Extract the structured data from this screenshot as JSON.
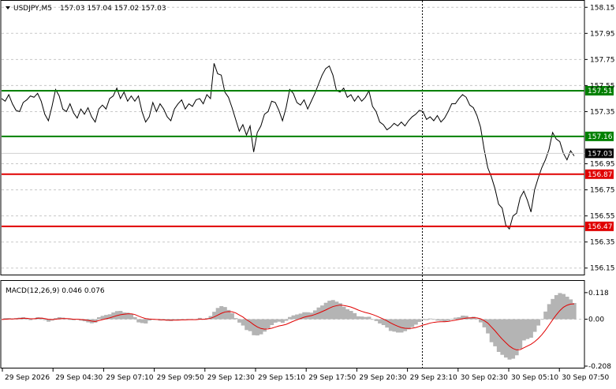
{
  "header": {
    "symbol_label": "USDJPY,M5",
    "ohlc": "157.03 157.04 157.02 157.03"
  },
  "macd_header": "MACD(12,26,9) 0.046 0.076",
  "colors": {
    "background": "#ffffff",
    "price_line": "#000000",
    "grid": "#c8c8c8",
    "resistance": "#008000",
    "support": "#e00000",
    "macd_hist": "#b4b4b4",
    "macd_signal": "#e00000",
    "current_price_bg": "#000000"
  },
  "chart_data": [
    {
      "type": "line",
      "title": "USDJPY,M5",
      "y_ticks": [
        "158.15",
        "157.95",
        "157.75",
        "157.55",
        "157.35",
        "156.95",
        "156.75",
        "156.55",
        "156.35",
        "156.15"
      ],
      "ylim": [
        156.1,
        158.2
      ],
      "x_tick_labels": [
        "29 Sep 2026",
        "29 Sep 04:30",
        "29 Sep 07:10",
        "29 Sep 09:50",
        "29 Sep 12:30",
        "29 Sep 15:10",
        "29 Sep 17:50",
        "29 Sep 20:30",
        "29 Sep 23:10",
        "30 Sep 02:30",
        "30 Sep 05:10",
        "30 Sep 07:50"
      ],
      "current_price": "157.03",
      "levels": [
        {
          "value": 157.51,
          "label": "157.51",
          "color": "#008000"
        },
        {
          "value": 157.16,
          "label": "157.16",
          "color": "#008000"
        },
        {
          "value": 156.87,
          "label": "156.87",
          "color": "#e00000"
        },
        {
          "value": 156.47,
          "label": "156.47",
          "color": "#e00000"
        }
      ],
      "series": [
        {
          "values": [
            157.45,
            157.43,
            157.48,
            157.41,
            157.36,
            157.35,
            157.42,
            157.44,
            157.47,
            157.46,
            157.49,
            157.43,
            157.33,
            157.28,
            157.39,
            157.52,
            157.47,
            157.37,
            157.35,
            157.41,
            157.34,
            157.3,
            157.37,
            157.33,
            157.38,
            157.31,
            157.27,
            157.37,
            157.4,
            157.37,
            157.45,
            157.47,
            157.53,
            157.45,
            157.5,
            157.43,
            157.47,
            157.43,
            157.47,
            157.35,
            157.27,
            157.31,
            157.42,
            157.35,
            157.41,
            157.37,
            157.31,
            157.28,
            157.37,
            157.41,
            157.44,
            157.37,
            157.41,
            157.39,
            157.44,
            157.45,
            157.41,
            157.48,
            157.45,
            157.72,
            157.64,
            157.63,
            157.5,
            157.46,
            157.38,
            157.29,
            157.2,
            157.25,
            157.17,
            157.24,
            157.04,
            157.19,
            157.24,
            157.33,
            157.35,
            157.43,
            157.42,
            157.36,
            157.28,
            157.38,
            157.52,
            157.49,
            157.42,
            157.4,
            157.44,
            157.37,
            157.43,
            157.49,
            157.56,
            157.63,
            157.68,
            157.7,
            157.63,
            157.51,
            157.5,
            157.53,
            157.46,
            157.48,
            157.43,
            157.47,
            157.43,
            157.46,
            157.51,
            157.39,
            157.35,
            157.27,
            157.25,
            157.21,
            157.23,
            157.26,
            157.24,
            157.27,
            157.24,
            157.28,
            157.31,
            157.33,
            157.36,
            157.35,
            157.29,
            157.31,
            157.28,
            157.32,
            157.27,
            157.3,
            157.35,
            157.41,
            157.41,
            157.45,
            157.48,
            157.46,
            157.4,
            157.38,
            157.32,
            157.23,
            157.06,
            156.92,
            156.85,
            156.76,
            156.64,
            156.61,
            156.48,
            156.45,
            156.55,
            156.57,
            156.69,
            156.74,
            156.67,
            156.58,
            156.75,
            156.84,
            156.92,
            156.98,
            157.06,
            157.19,
            157.14,
            157.12,
            157.03,
            156.98,
            157.05,
            157.01
          ]
        }
      ]
    },
    {
      "type": "bar",
      "title": "MACD(12,26,9)",
      "y_ticks": [
        "0.118",
        "0.00",
        "-0.208"
      ],
      "ylim": [
        -0.215,
        0.17
      ],
      "series": [
        {
          "name": "MACD",
          "values": [
            0.0,
            0.005,
            0.005,
            0.003,
            0.005,
            0.007,
            0.009,
            0.003,
            -0.004,
            0.004,
            0.009,
            0.007,
            -0.004,
            -0.011,
            -0.006,
            0.005,
            0.009,
            0.007,
            0.003,
            -0.003,
            -0.004,
            0.001,
            -0.006,
            -0.009,
            -0.014,
            -0.018,
            -0.015,
            0.009,
            0.015,
            0.019,
            0.022,
            0.03,
            0.036,
            0.037,
            0.03,
            0.029,
            0.025,
            0.009,
            -0.014,
            -0.017,
            -0.019,
            -0.006,
            -0.002,
            -0.002,
            -0.006,
            -0.005,
            -0.007,
            -0.008,
            -0.003,
            -0.004,
            -0.001,
            -0.003,
            0.001,
            -0.001,
            -0.001,
            0.006,
            0.0,
            0.005,
            0.014,
            0.033,
            0.05,
            0.058,
            0.054,
            0.041,
            0.027,
            0.005,
            -0.015,
            -0.028,
            -0.048,
            -0.053,
            -0.071,
            -0.072,
            -0.067,
            -0.055,
            -0.04,
            -0.026,
            -0.015,
            -0.011,
            -0.016,
            -0.007,
            0.01,
            0.017,
            0.021,
            0.025,
            0.031,
            0.031,
            0.029,
            0.039,
            0.052,
            0.061,
            0.073,
            0.082,
            0.085,
            0.078,
            0.071,
            0.055,
            0.044,
            0.037,
            0.027,
            0.013,
            0.012,
            0.01,
            0.011,
            0.0,
            -0.008,
            -0.019,
            -0.026,
            -0.037,
            -0.052,
            -0.055,
            -0.059,
            -0.059,
            -0.053,
            -0.045,
            -0.035,
            -0.024,
            -0.012,
            -0.003,
            -0.004,
            0.003,
            0.0,
            -0.006,
            -0.007,
            -0.012,
            -0.007,
            0.002,
            0.007,
            0.009,
            0.016,
            0.015,
            0.008,
            0.011,
            0.003,
            -0.014,
            -0.036,
            -0.063,
            -0.102,
            -0.12,
            -0.145,
            -0.158,
            -0.17,
            -0.179,
            -0.175,
            -0.16,
            -0.131,
            -0.094,
            -0.088,
            -0.082,
            -0.056,
            -0.028,
            -0.002,
            0.034,
            0.067,
            0.09,
            0.107,
            0.116,
            0.112,
            0.1,
            0.088,
            0.072
          ]
        },
        {
          "name": "Signal",
          "values": [
            -0.001,
            0.0,
            0.001,
            0.001,
            0.002,
            0.003,
            0.004,
            0.004,
            0.002,
            0.002,
            0.004,
            0.005,
            0.003,
            0.0,
            -0.001,
            0.0,
            0.002,
            0.003,
            0.003,
            0.002,
            0.0,
            0.0,
            -0.001,
            -0.003,
            -0.005,
            -0.008,
            -0.01,
            -0.006,
            -0.002,
            0.002,
            0.006,
            0.011,
            0.016,
            0.02,
            0.022,
            0.024,
            0.024,
            0.021,
            0.014,
            0.008,
            0.003,
            0.001,
            0.0,
            -0.001,
            -0.002,
            -0.003,
            -0.004,
            -0.004,
            -0.004,
            -0.004,
            -0.003,
            -0.003,
            -0.002,
            -0.002,
            -0.002,
            0.0,
            0.0,
            0.001,
            0.004,
            0.01,
            0.018,
            0.026,
            0.032,
            0.034,
            0.033,
            0.028,
            0.019,
            0.01,
            -0.002,
            -0.012,
            -0.024,
            -0.034,
            -0.041,
            -0.044,
            -0.043,
            -0.04,
            -0.035,
            -0.03,
            -0.027,
            -0.023,
            -0.016,
            -0.009,
            -0.003,
            0.003,
            0.009,
            0.013,
            0.016,
            0.021,
            0.027,
            0.034,
            0.041,
            0.049,
            0.056,
            0.06,
            0.063,
            0.061,
            0.058,
            0.054,
            0.048,
            0.041,
            0.035,
            0.03,
            0.026,
            0.021,
            0.015,
            0.008,
            0.001,
            -0.007,
            -0.016,
            -0.024,
            -0.031,
            -0.037,
            -0.04,
            -0.041,
            -0.04,
            -0.037,
            -0.032,
            -0.026,
            -0.022,
            -0.017,
            -0.014,
            -0.012,
            -0.011,
            -0.011,
            -0.01,
            -0.007,
            -0.004,
            -0.001,
            0.002,
            0.005,
            0.006,
            0.007,
            0.006,
            0.002,
            -0.006,
            -0.017,
            -0.034,
            -0.051,
            -0.07,
            -0.088,
            -0.104,
            -0.119,
            -0.13,
            -0.136,
            -0.135,
            -0.127,
            -0.119,
            -0.111,
            -0.1,
            -0.086,
            -0.069,
            -0.049,
            -0.026,
            -0.003,
            0.019,
            0.038,
            0.053,
            0.062,
            0.067,
            0.068
          ]
        }
      ]
    }
  ]
}
